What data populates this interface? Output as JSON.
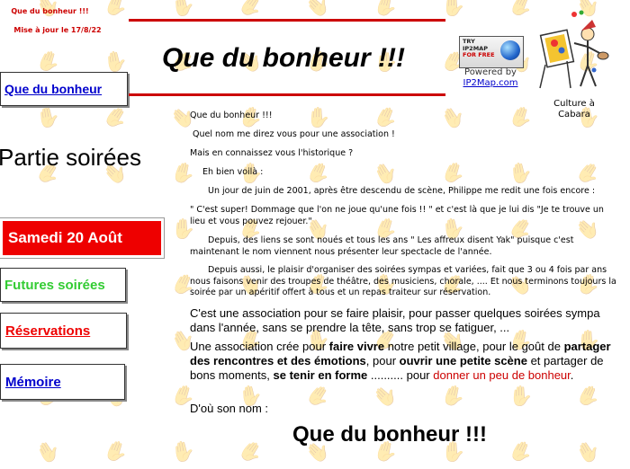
{
  "sidebar": {
    "site_title_small": "Que du bonheur !!!",
    "update_date": "Mise à jour le 17/8/22",
    "nav_home": "Que du bonheur",
    "section_title": "Partie soirées",
    "nav_current": "Samedi 20 Août",
    "nav_future": "Futures soirées",
    "nav_reservations": "Réservations",
    "nav_memoire": "Mémoire"
  },
  "header": {
    "title": "Que du bonheur !!!",
    "badge_line1": "TRY",
    "badge_line2": "IP2MAP",
    "badge_line3": "FOR FREE",
    "powered_by": "Powered by",
    "powered_link": "IP2Map.com",
    "logo_caption_line1": "Culture à",
    "logo_caption_line2": "Cabara"
  },
  "content": {
    "p1": "Que du bonheur !!!",
    "p2": "Quel nom me direz vous pour une association !",
    "p3": "Mais en connaissez vous l'historique ?",
    "p4": "Eh bien voilà :",
    "p5": "Un jour de juin de 2001, après être descendu de scène, Philippe me redit une fois encore :",
    "p6": "\" C'est super! Dommage que l'on ne joue qu'une fois !! \" et c'est là que je lui dis  \"Je te trouve un lieu et vous pouvez rejouer.\"",
    "p7": "Depuis, des liens se sont noués et tous les ans \" Les affreux disent Yak\" puisque c'est maintenant le nom viennent nous présenter leur spectacle de l'année.",
    "p8": "Depuis aussi, le plaisir d'organiser des soirées sympas et variées, fait que 3 ou 4 fois par ans nous faisons venir des troupes de théâtre, des musiciens, chorale, .... Et nous terminons toujours la soirée par un apéritif offert à tous et un repas traiteur sur réservation.",
    "big1": "C'est une association pour se faire plaisir, pour passer quelques soirées sympa dans l'année, sans se prendre la tête, sans trop se fatiguer, ...",
    "big2_a": "Une association crée pour ",
    "big2_b": "faire vivre",
    "big2_c": " notre petit village, pour le goût  de ",
    "big2_d": "partager des rencontres et des émotions",
    "big2_e": ", pour ",
    "big2_f": "ouvrir une petite scène",
    "big2_g": " et partager de bons moments, ",
    "big2_h": "se tenir en forme",
    "big2_i": " .......... pour ",
    "big2_j": "donner un peu de bonheur",
    "big2_k": ".",
    "big3": "D'où son nom  :",
    "bottom_title": "Que du bonheur !!!"
  },
  "colors": {
    "accent_red": "#cc0000",
    "link_blue": "#0000cc",
    "future_green": "#33cc33"
  }
}
